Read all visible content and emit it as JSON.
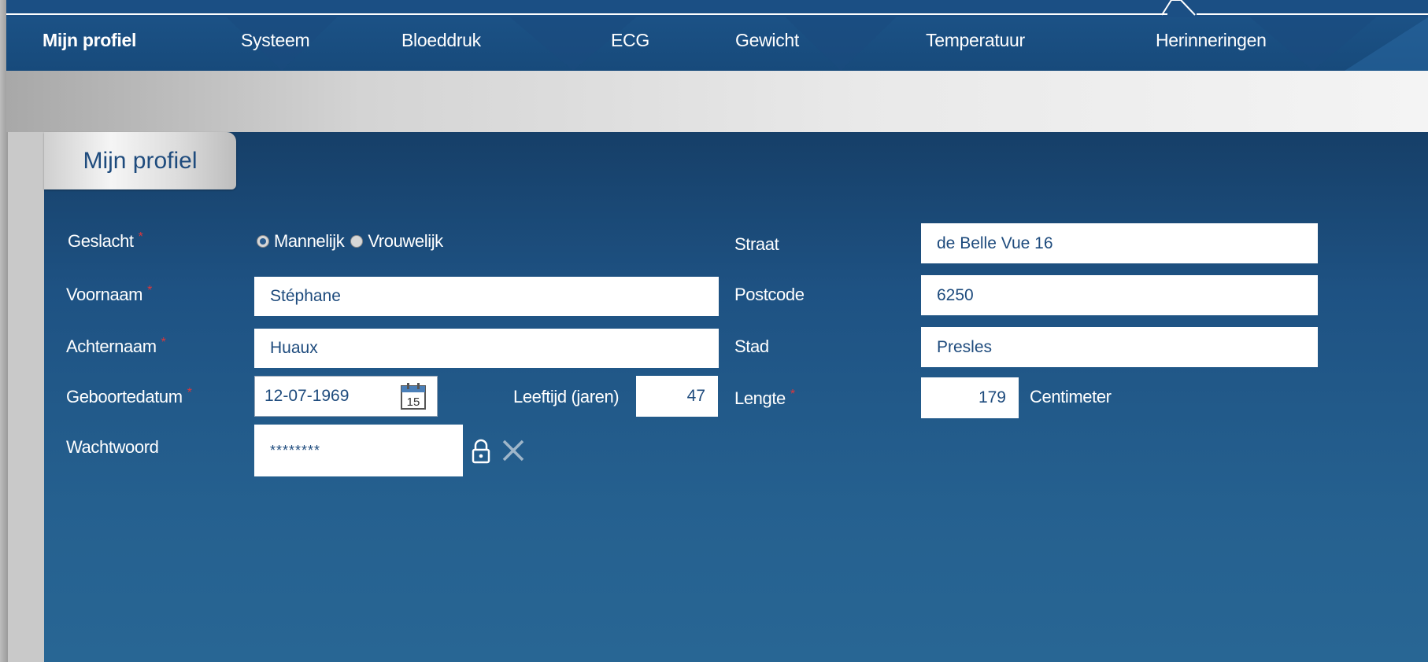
{
  "nav": {
    "items": [
      {
        "label": "Mijn profiel",
        "active": true
      },
      {
        "label": "Systeem",
        "active": false
      },
      {
        "label": "Bloeddruk",
        "active": false
      },
      {
        "label": "ECG",
        "active": false
      },
      {
        "label": "Gewicht",
        "active": false
      },
      {
        "label": "Temperatuur",
        "active": false
      },
      {
        "label": "Herinneringen",
        "active": false
      }
    ]
  },
  "tab": {
    "label": "Mijn profiel"
  },
  "form": {
    "required_marker": "*",
    "gender": {
      "label": "Geslacht",
      "options": [
        "Mannelijk",
        "Vrouwelijk"
      ],
      "selected": "Mannelijk"
    },
    "first_name": {
      "label": "Voornaam",
      "value": "Stéphane"
    },
    "last_name": {
      "label": "Achternaam",
      "value": "Huaux"
    },
    "birthdate": {
      "label": "Geboortedatum",
      "value": "12-07-1969",
      "calendar_day": "15"
    },
    "age": {
      "label": "Leeftijd (jaren)",
      "value": "47"
    },
    "password": {
      "label": "Wachtwoord",
      "value": "********"
    },
    "street": {
      "label": "Straat",
      "value": "de Belle Vue 16"
    },
    "postcode": {
      "label": "Postcode",
      "value": "6250"
    },
    "city": {
      "label": "Stad",
      "value": "Presles"
    },
    "height": {
      "label": "Lengte",
      "value": "179",
      "unit": "Centimeter"
    }
  },
  "icons": {
    "calendar": "calendar-icon",
    "lock": "lock-icon",
    "clear": "close-icon"
  },
  "colors": {
    "nav_bg": "#1d5489",
    "panel_bg": "#1e5283",
    "field_text": "#1e4b7d",
    "required": "#e0373a"
  }
}
